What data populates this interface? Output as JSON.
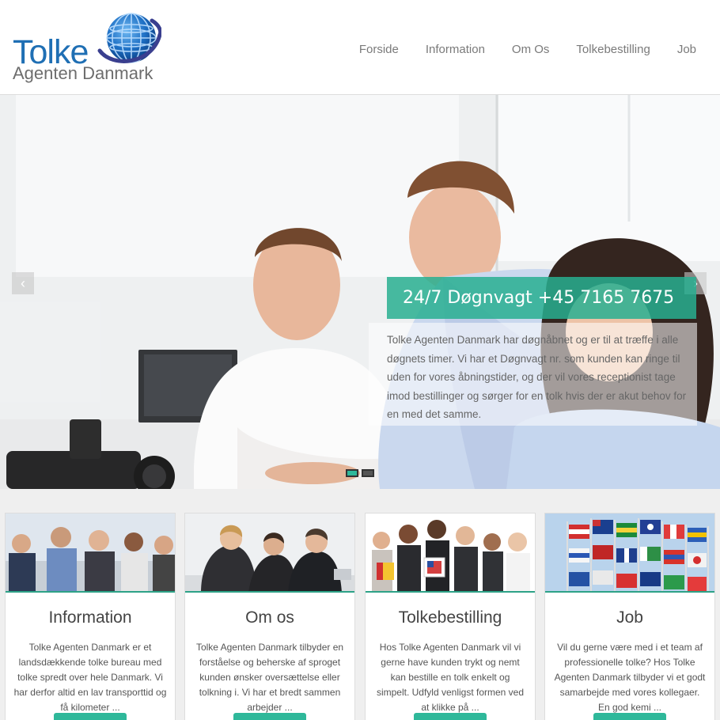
{
  "logo": {
    "name_line1": "Tolke",
    "name_line2": "Agenten Danmark",
    "globe_icon": "globe-icon",
    "colors": {
      "brand_blue": "#1f6fb4",
      "brand_gray": "#6d6d6d"
    }
  },
  "nav": {
    "items": [
      {
        "label": "Forside"
      },
      {
        "label": "Information"
      },
      {
        "label": "Om Os"
      },
      {
        "label": "Tolkebestilling"
      },
      {
        "label": "Job"
      }
    ]
  },
  "hero": {
    "caption_title": "24/7 Døgnvagt +45 7165 7675",
    "caption_text": "Tolke Agenten Danmark har døgnåbnet og er til at træffe i alle døgnets timer. Vi har et Døgnvagt nr. som kunden kan ringe til uden for vores åbningstider, og der vil vores receptionist tage imod bestillinger og sørger for en tolk hvis der er akut behov for en med det samme.",
    "prev_icon": "chevron-left-icon",
    "next_icon": "chevron-right-icon",
    "slide_count": 2,
    "active_slide": 1,
    "accent": "#28af91"
  },
  "cards": [
    {
      "title": "Information",
      "text": "Tolke Agenten Danmark er et landsdækkende tolke bureau med tolke spredt over hele Danmark. Vi har derfor altid en lav transporttid og få kilometer ..."
    },
    {
      "title": "Om os",
      "text": "Tolke Agenten Danmark tilbyder en forståelse og beherske af sproget kunden ønsker oversættelse eller tolkning i. Vi har et bredt sammen arbejder ..."
    },
    {
      "title": "Tolkebestilling",
      "text": "Hos Tolke Agenten Danmark vil vi gerne have kunden trykt og nemt kan bestille en tolk enkelt og simpelt. Udfyld venligst formen ved at klikke på ..."
    },
    {
      "title": "Job",
      "text": "Vil du gerne være med i et team af professionelle tolke? Hos Tolke Agenten Danmark tilbyder vi et godt samarbejde med vores kollegaer. En god kemi ..."
    }
  ]
}
